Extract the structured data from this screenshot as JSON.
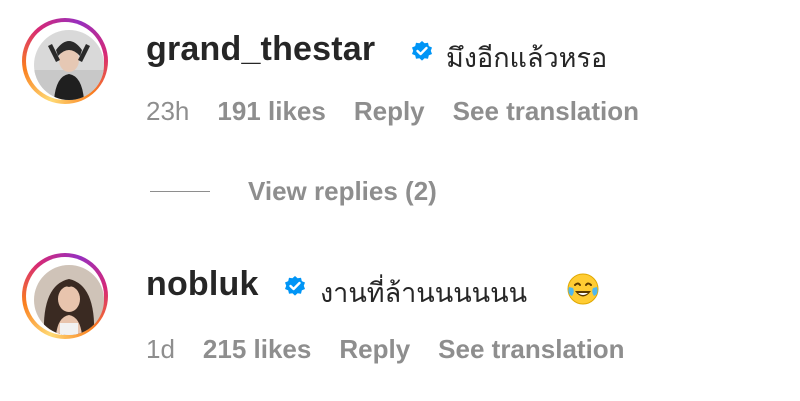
{
  "comments": [
    {
      "username": "grand_thestar",
      "text": "มึงอีกแล้วหรอ",
      "time": "23h",
      "likes": "191 likes",
      "reply": "Reply",
      "translate": "See translation",
      "verified_icon": "verified-badge-icon"
    },
    {
      "username": "nobluk",
      "text": "งานที่ล้านนนนนน",
      "time": "1d",
      "likes": "215 likes",
      "reply": "Reply",
      "translate": "See translation",
      "verified_icon": "verified-badge-icon",
      "emoji": "face-with-tears-of-joy"
    }
  ],
  "view_replies": "View replies (2)",
  "colors": {
    "text": "#262626",
    "secondary": "#8e8e8e",
    "verified": "#0095f6"
  }
}
